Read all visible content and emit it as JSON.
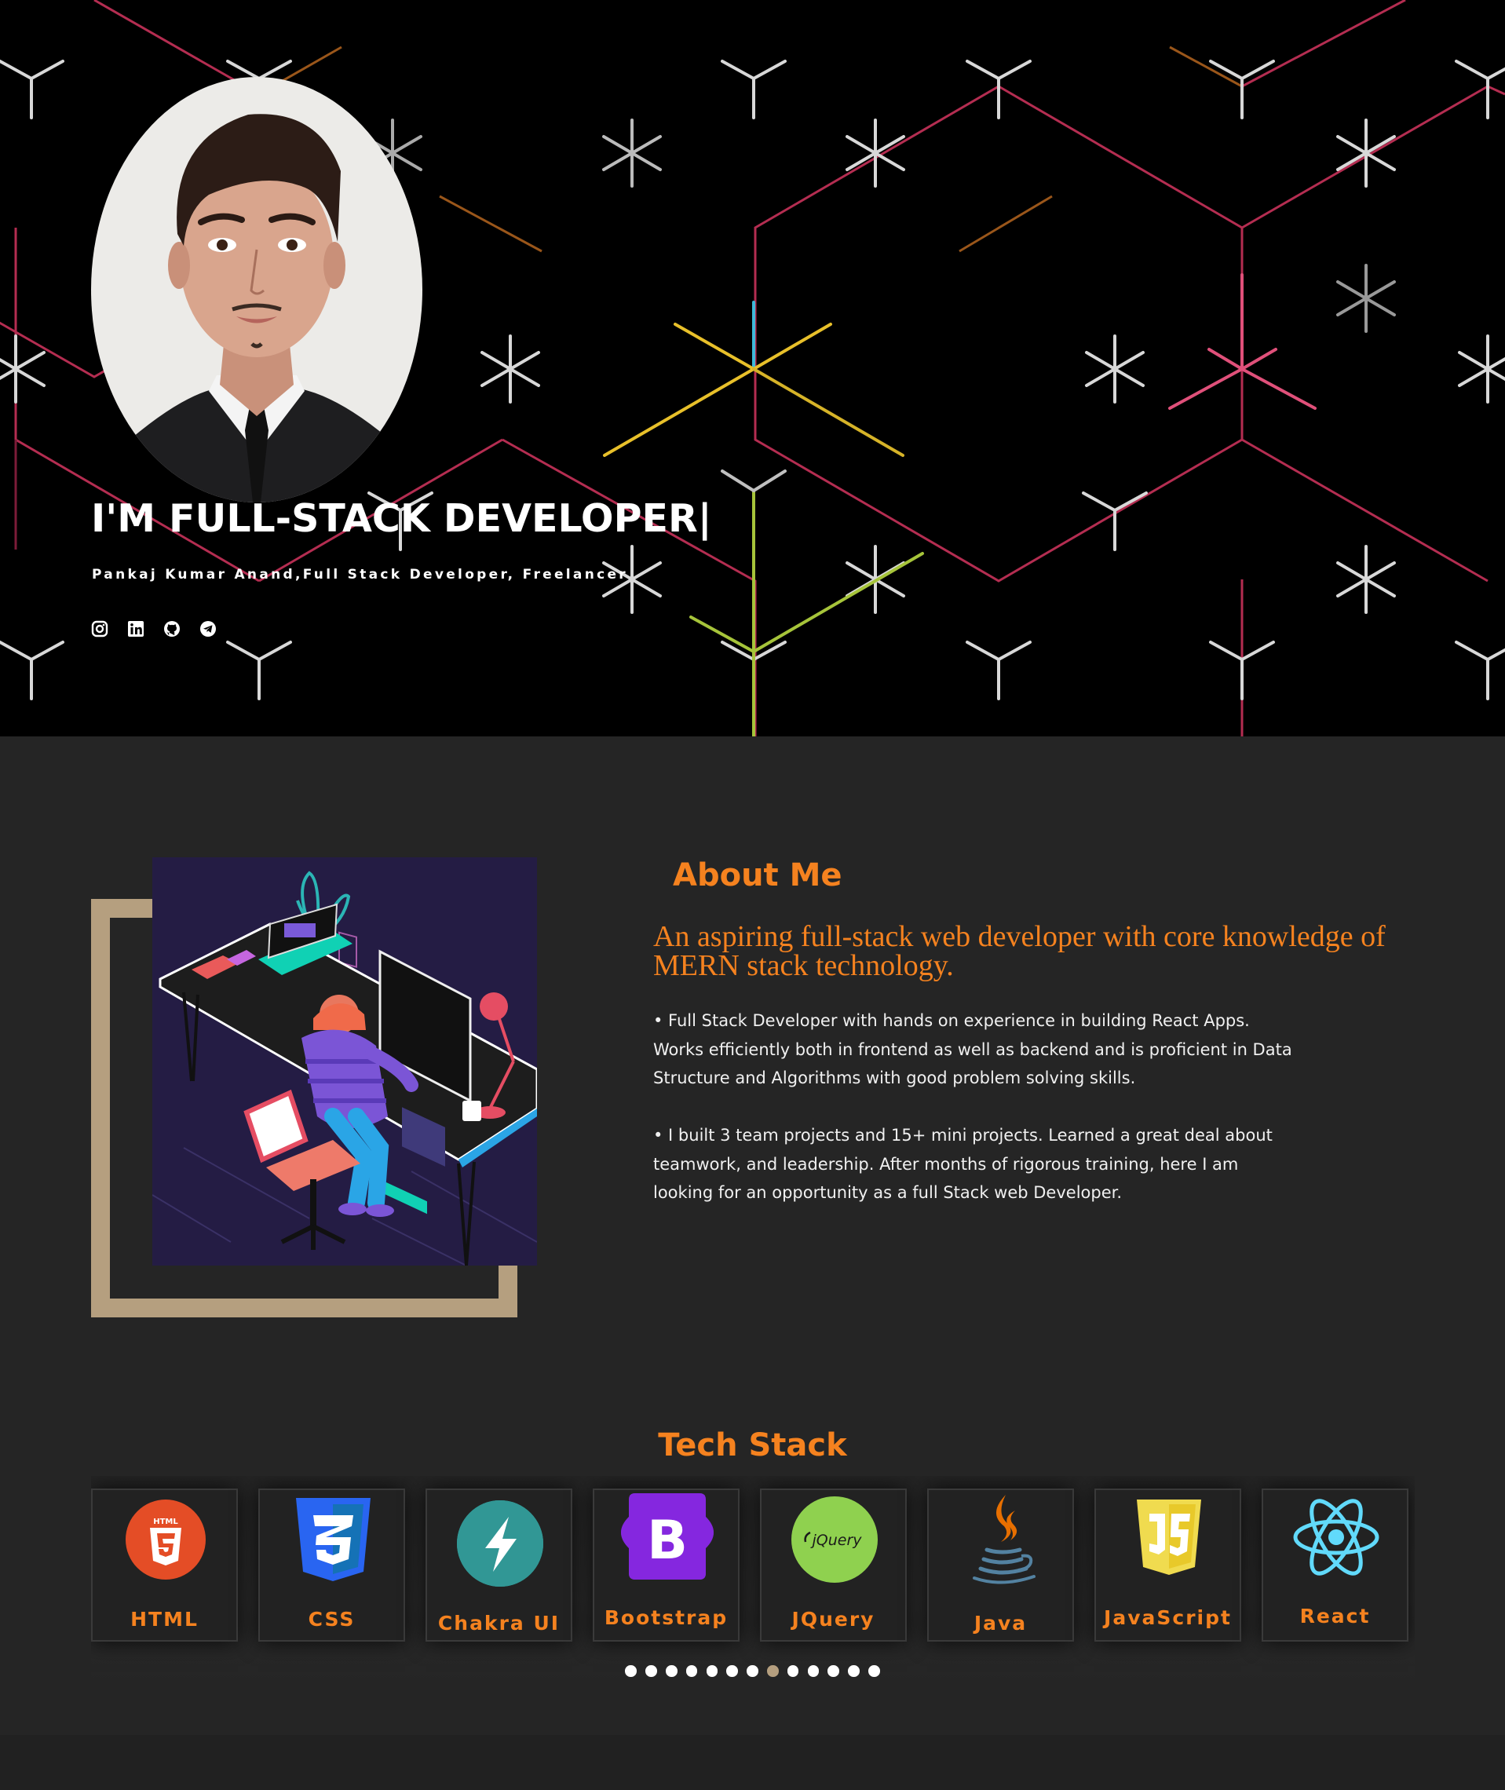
{
  "hero": {
    "title": "I'M FULL-STACK DEVELOPER|",
    "subtitle": "Pankaj Kumar Anand,Full Stack Developer, Freelancer",
    "socials": [
      {
        "icon": "instagram-icon"
      },
      {
        "icon": "linkedin-icon"
      },
      {
        "icon": "github-icon"
      },
      {
        "icon": "telegram-icon"
      }
    ]
  },
  "about": {
    "heading": "About Me",
    "tagline": "An aspiring full-stack web developer with core knowledge of MERN stack technology.",
    "paragraph1": "• Full Stack Developer with hands on experience in building React Apps. Works efficiently both in frontend as well as backend and is proficient in Data Structure and Algorithms with good problem solving skills.",
    "paragraph2": "• I built 3 team projects and 15+ mini projects. Learned a great deal about teamwork, and leadership. After months of rigorous training, here I am looking for an opportunity as a full Stack web Developer."
  },
  "tech": {
    "heading": "Tech Stack",
    "items": [
      {
        "label": "HTML",
        "icon": "html5-icon"
      },
      {
        "label": "CSS",
        "icon": "css3-icon"
      },
      {
        "label": "Chakra UI",
        "icon": "chakra-ui-icon"
      },
      {
        "label": "Bootstrap",
        "icon": "bootstrap-icon"
      },
      {
        "label": "JQuery",
        "icon": "jquery-icon"
      },
      {
        "label": "Java",
        "icon": "java-icon"
      },
      {
        "label": "JavaScript",
        "icon": "javascript-icon"
      },
      {
        "label": "React",
        "icon": "react-icon"
      }
    ],
    "dot_count": 13,
    "active_dot": 7
  },
  "colors": {
    "accent": "#f5821f",
    "frame": "#b59f7f",
    "background": "#252525",
    "hero_background": "#000000"
  }
}
